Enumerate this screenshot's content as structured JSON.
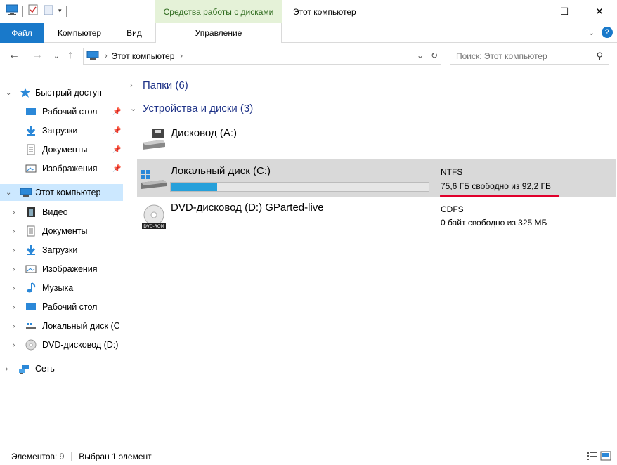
{
  "titlebar": {
    "context_group": "Средства работы с дисками",
    "title": "Этот компьютер",
    "minimize_glyph": "—",
    "maximize_glyph": "☐",
    "close_glyph": "✕"
  },
  "ribbon": {
    "tabs": {
      "file": "Файл",
      "computer": "Компьютер",
      "view": "Вид",
      "manage": "Управление"
    }
  },
  "address": {
    "crumb": "Этот компьютер",
    "separator": "›"
  },
  "search": {
    "placeholder": "Поиск: Этот компьютер"
  },
  "sidebar": {
    "quick_access": "Быстрый доступ",
    "quick_items": [
      "Рабочий стол",
      "Загрузки",
      "Документы",
      "Изображения"
    ],
    "this_pc": "Этот компьютер",
    "pc_items": [
      "Видео",
      "Документы",
      "Загрузки",
      "Изображения",
      "Музыка",
      "Рабочий стол",
      "Локальный диск (C",
      "DVD-дисковод (D:)"
    ],
    "network": "Сеть"
  },
  "content": {
    "folders_group": "Папки (6)",
    "devices_group": "Устройства и диски (3)",
    "drives": [
      {
        "name": "Дисковод (A:)",
        "fs": "",
        "free": ""
      },
      {
        "name": "Локальный диск (C:)",
        "fs": "NTFS",
        "free": "75,6 ГБ свободно из 92,2 ГБ",
        "used_fraction": 0.18
      },
      {
        "name": "DVD-дисковод (D:) GParted-live",
        "fs": "CDFS",
        "free": "0 байт свободно из 325 МБ",
        "icon_label": "DVD-ROM"
      }
    ]
  },
  "status": {
    "items_count": "Элементов: 9",
    "selected": "Выбран 1 элемент"
  },
  "colors": {
    "accent": "#1979ca",
    "selection": "#cce8ff",
    "drive_selected": "#d9d9d9",
    "usage_bar": "#26a0da",
    "highlight_underline": "#e0002b",
    "context_tab": "#e5f2d8"
  }
}
